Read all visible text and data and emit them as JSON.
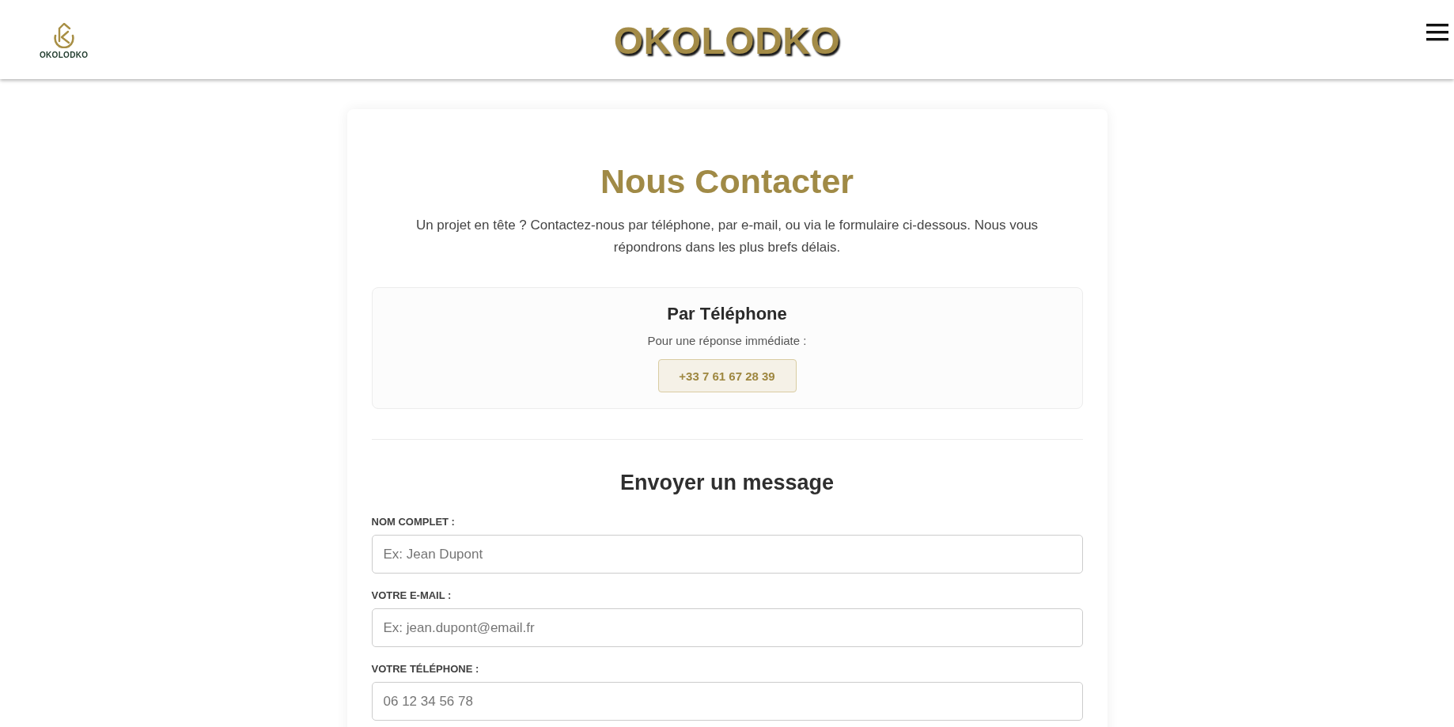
{
  "header": {
    "logo": {
      "text": "OKOLODKO"
    },
    "title": "OKOLODKO"
  },
  "contact": {
    "title": "Nous Contacter",
    "intro": "Un projet en tête ? Contactez-nous par téléphone, par e-mail, ou via le formulaire ci-dessous. Nous vous répondrons dans les plus brefs délais.",
    "phone_card": {
      "title": "Par Téléphone",
      "subtitle": "Pour une réponse immédiate :",
      "number": "+33 7 61 67 28 39"
    }
  },
  "form": {
    "title": "Envoyer un message",
    "fields": [
      {
        "label": "NOM COMPLET :",
        "placeholder": "Ex: Jean Dupont"
      },
      {
        "label": "VOTRE E-MAIL :",
        "placeholder": "Ex: jean.dupont@email.fr"
      },
      {
        "label": "VOTRE TÉLÉPHONE :",
        "placeholder": "06 12 34 56 78"
      }
    ]
  }
}
